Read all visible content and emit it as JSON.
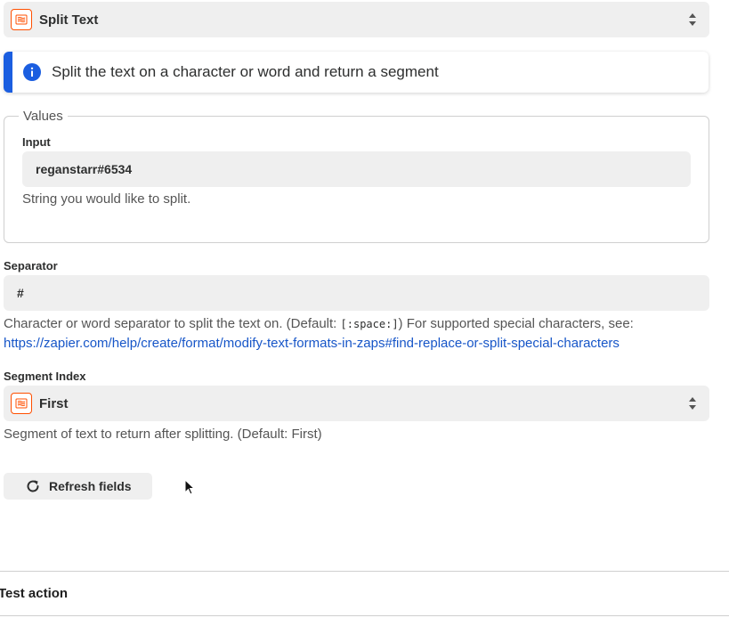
{
  "event_select": {
    "value": "Split Text",
    "icon": "formatter-icon"
  },
  "info_banner": {
    "text": "Split the text on a character or word and return a segment",
    "accent_color": "#1b5ee0"
  },
  "values_group": {
    "legend": "Values",
    "input": {
      "label": "Input",
      "value": "reganstarr#6534",
      "help": "String you would like to split."
    }
  },
  "separator": {
    "label": "Separator",
    "value": "#",
    "help_prefix": "Character or word separator to split the text on. (Default: ",
    "help_code": "[:space:]",
    "help_suffix": ") For supported special characters, see:",
    "help_link": "https://zapier.com/help/create/format/modify-text-formats-in-zaps#find-replace-or-split-special-characters"
  },
  "segment_index": {
    "label": "Segment Index",
    "value": "First",
    "help": "Segment of text to return after splitting. (Default: First)"
  },
  "refresh_button": {
    "label": "Refresh fields"
  },
  "test_action": {
    "label": "Test action"
  },
  "colors": {
    "field_bg": "#efefef",
    "brand_orange": "#ff4f00",
    "link": "#1756c8"
  }
}
